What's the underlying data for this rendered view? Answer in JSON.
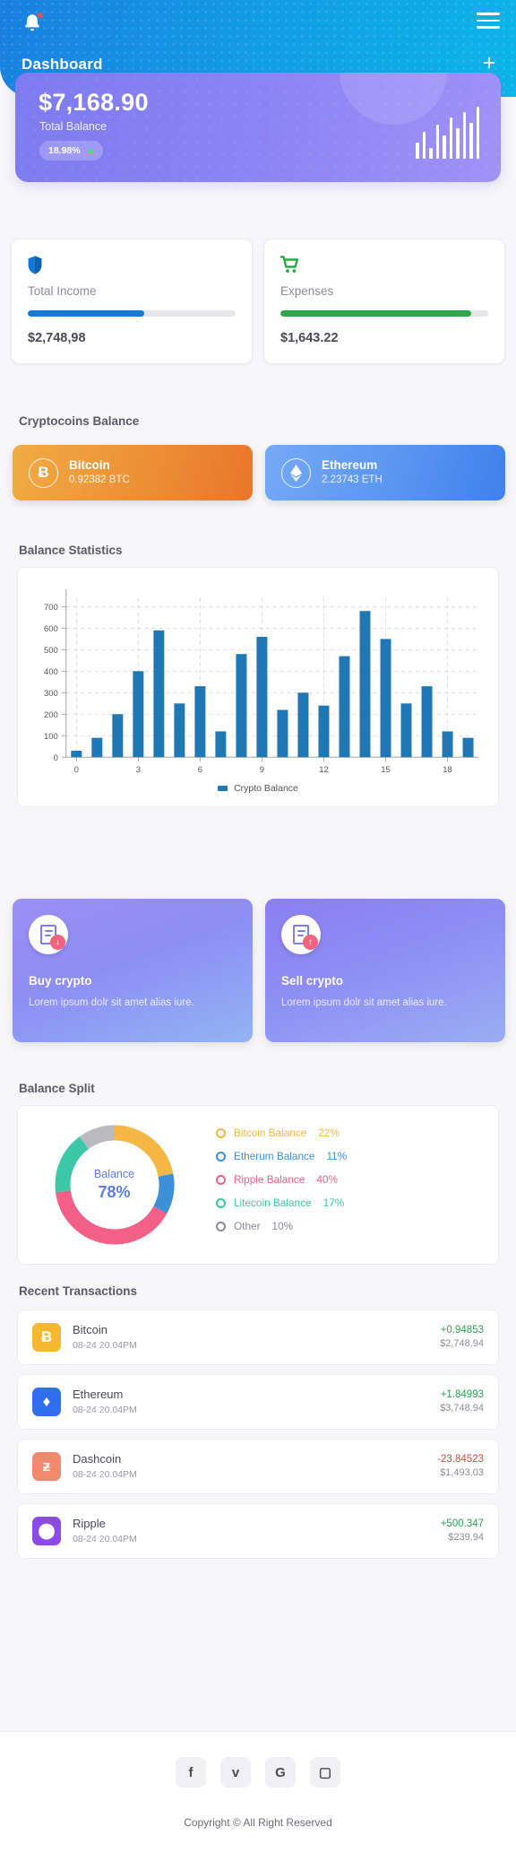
{
  "header": {
    "title": "Dashboard",
    "bell_icon": "bell-icon",
    "menu_icon": "hamburger-icon",
    "add_icon": "plus-icon"
  },
  "balance": {
    "amount": "$7,168.90",
    "label": "Total Balance",
    "change_pct": "18.98%",
    "change_direction": "up",
    "spark_values": [
      18,
      30,
      12,
      38,
      26,
      46,
      34,
      52,
      40,
      58
    ],
    "gradient_from": "#7d7bf0",
    "gradient_to": "#9f92f7"
  },
  "stats": [
    {
      "icon": "shield-icon",
      "title": "Total Income",
      "value": "$2,748,98",
      "progress": 56,
      "color": "#1479d6"
    },
    {
      "icon": "cart-icon",
      "title": "Expenses",
      "value": "$1,643.22",
      "progress": 92,
      "color": "#2ba84a"
    }
  ],
  "cryptocoins": {
    "section_title": "Cryptocoins Balance",
    "items": [
      {
        "symbol": "Ƀ",
        "name": "Bitcoin",
        "amount": "0.92382 BTC",
        "theme": "btc"
      },
      {
        "symbol": "♦",
        "name": "Ethereum",
        "amount": "2.23743 ETH",
        "theme": "eth"
      }
    ]
  },
  "balance_statistics": {
    "section_title": "Balance Statistics"
  },
  "chart_data": {
    "type": "bar",
    "title": "Balance Statistics",
    "xlabel": "",
    "ylabel": "",
    "legend": [
      "Crypto Balance"
    ],
    "legend_position": "bottom",
    "grid": true,
    "series_color": "#1f77b4",
    "ylim": [
      0,
      740
    ],
    "yticks": [
      0,
      100,
      200,
      300,
      400,
      500,
      600,
      700
    ],
    "xticks": [
      0,
      3,
      6,
      9,
      12,
      15,
      18
    ],
    "x": [
      0,
      1,
      2,
      3,
      4,
      5,
      6,
      7,
      8,
      9,
      10,
      11,
      12,
      13,
      14,
      15,
      16,
      17,
      18,
      19
    ],
    "series": [
      {
        "name": "Crypto Balance",
        "values": [
          30,
          90,
          200,
          400,
          590,
          250,
          330,
          120,
          480,
          560,
          220,
          300,
          240,
          470,
          680,
          550,
          250,
          330,
          120,
          90
        ]
      }
    ]
  },
  "promos": [
    {
      "icon": "document-down-icon",
      "badge": "↓",
      "title": "Buy crypto",
      "desc": "Lorem ipsum dolr sit amet alias iure."
    },
    {
      "icon": "document-up-icon",
      "badge": "↑",
      "title": "Sell crypto",
      "desc": "Lorem ipsum dolr sit amet alias iure."
    }
  ],
  "balance_split": {
    "section_title": "Balance Split",
    "center_label": "Balance",
    "center_value": "78%",
    "chart_data": {
      "type": "pie",
      "title": "Balance Split",
      "labels": [
        "Bitcoin Balance",
        "Etherum Balance",
        "Ripple Balance",
        "Litecoin Balance",
        "Other"
      ],
      "values": [
        22,
        11,
        40,
        17,
        10
      ],
      "colors": [
        "#f5b744",
        "#3d8fd8",
        "#f25f87",
        "#3cc8a6",
        "#b9b9bf"
      ]
    },
    "legend": [
      {
        "label": "Bitcoin Balance",
        "pct": "22%",
        "color": "#f5b744"
      },
      {
        "label": "Etherum Balance",
        "pct": "11%",
        "color": "#3d8fd8"
      },
      {
        "label": "Ripple Balance",
        "pct": "40%",
        "color": "#f25f87"
      },
      {
        "label": "Litecoin Balance",
        "pct": "17%",
        "color": "#3cc8a6"
      },
      {
        "label": "Other",
        "pct": "10%",
        "color": "#8b8b95"
      }
    ]
  },
  "transactions": {
    "section_title": "Recent Transactions",
    "rows": [
      {
        "icon_symbol": "Ƀ",
        "icon_bg": "#f7b731",
        "name": "Bitcoin",
        "date": "08-24   20.04PM",
        "delta": "+0.94853",
        "delta_color": "#2aa14e",
        "usd": "$2,748.94"
      },
      {
        "icon_symbol": "♦",
        "icon_bg": "#2f6fed",
        "name": "Ethereum",
        "date": "08-24   20.04PM",
        "delta": "+1.84993",
        "delta_color": "#2aa14e",
        "usd": "$3,748.94"
      },
      {
        "icon_symbol": "ƶ",
        "icon_bg": "#f08a6e",
        "name": "Dashcoin",
        "date": "08-24   20.04PM",
        "delta": "-23.84523",
        "delta_color": "#e0463c",
        "usd": "$1,493.03"
      },
      {
        "icon_symbol": "⬤",
        "icon_bg": "#8b4ae8",
        "name": "Ripple",
        "date": "08-24   20.04PM",
        "delta": "+500.347",
        "delta_color": "#2aa14e",
        "usd": "$239.94"
      }
    ]
  },
  "footer": {
    "social": [
      {
        "name": "facebook-icon",
        "glyph": "f"
      },
      {
        "name": "twitter-icon",
        "glyph": "ᴠ"
      },
      {
        "name": "google-icon",
        "glyph": "G"
      },
      {
        "name": "instagram-icon",
        "glyph": "▢"
      }
    ],
    "copyright": "Copyright © All Right Reserved"
  }
}
